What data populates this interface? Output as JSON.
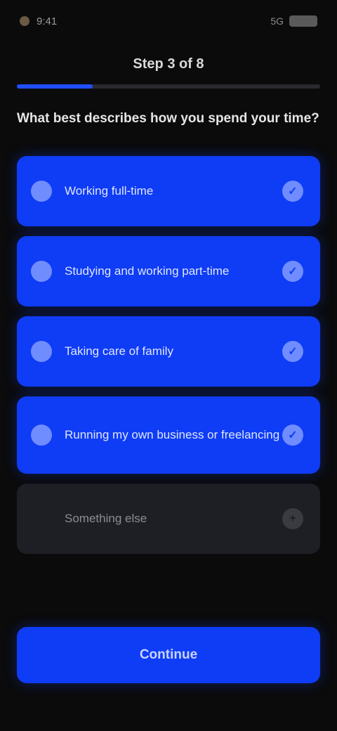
{
  "status_bar": {
    "time": "9:41",
    "signal": "5G"
  },
  "header": {
    "title": "Step 3 of 8",
    "progress": 0.25
  },
  "question": "What best describes how you spend your time?",
  "options": [
    {
      "label": "Working full-time",
      "selected": true
    },
    {
      "label": "Studying and working part-time",
      "selected": true
    },
    {
      "label": "Taking care of family",
      "selected": true
    },
    {
      "label": "Running my own business or freelancing",
      "selected": true
    },
    {
      "label": "Something else",
      "selected": false
    }
  ],
  "continue_label": "Continue",
  "colors": {
    "accent": "#0f3cf5",
    "background": "#0b0b0c",
    "muted_option": "#1e1f24"
  }
}
